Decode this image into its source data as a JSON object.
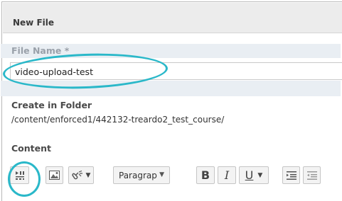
{
  "dialog": {
    "title": "New File"
  },
  "form": {
    "file_name": {
      "label": "File Name *",
      "value": "video-upload-test"
    },
    "create_in_folder": {
      "label": "Create in Folder",
      "value": "/content/enforced1/442132-treardo2_test_course/"
    },
    "content": {
      "label": "Content"
    }
  },
  "toolbar": {
    "format_select_value": "Paragrap",
    "bold_label": "B",
    "italic_label": "I",
    "underline_label": "U",
    "buttons": [
      "insert-media",
      "insert-image",
      "insert-link",
      "format",
      "bold",
      "italic",
      "underline",
      "indent",
      "outdent"
    ]
  },
  "colors": {
    "highlight_ellipse": "#2ab8c9",
    "header_bg": "#ececec",
    "row_shade": "#e9eef3"
  }
}
